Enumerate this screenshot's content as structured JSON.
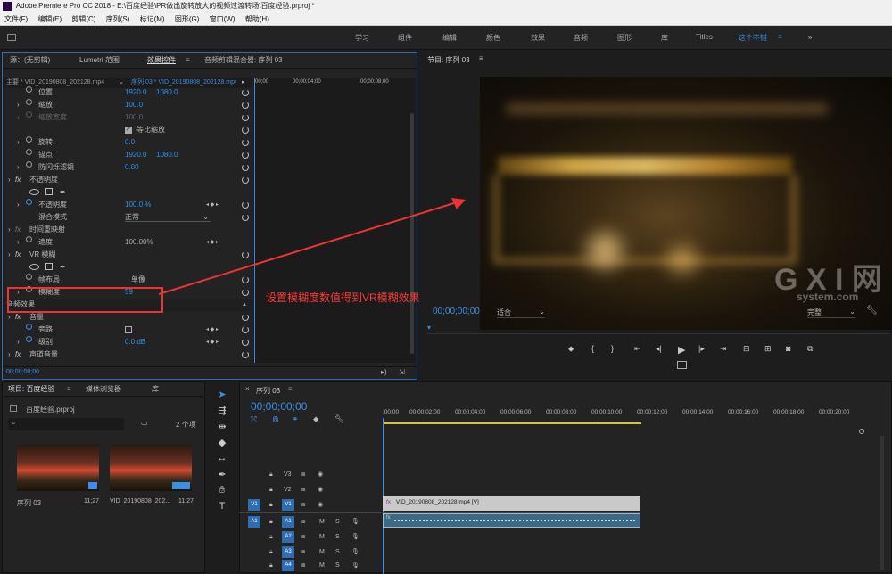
{
  "window": {
    "title": "Adobe Premiere Pro CC 2018 - E:\\百度经验\\PR做出旋转放大的视频过渡转场\\百度经验.prproj *"
  },
  "menu": [
    "文件(F)",
    "编辑(E)",
    "剪辑(C)",
    "序列(S)",
    "标记(M)",
    "图形(G)",
    "窗口(W)",
    "帮助(H)"
  ],
  "workspaces": [
    "学习",
    "组件",
    "编辑",
    "颜色",
    "效果",
    "音频",
    "图形",
    "库",
    "Titles",
    "这个不错",
    "»"
  ],
  "source_panel": {
    "tabs": [
      "源：(无剪辑)",
      "Lumetri 范围",
      "效果控件",
      "音频剪辑混合器: 序列 03"
    ],
    "master": "主要 * VID_20190808_202128.mp4",
    "seq": "序列 03 * VID_20190808_202128.mp4",
    "timecode_top": "00;00",
    "ruler": [
      "00;00;04;00",
      "00;00;08;00"
    ],
    "rows": [
      {
        "label": "位置",
        "v1": "1920.0",
        "v2": "1080.0"
      },
      {
        "label": "缩放",
        "v1": "100.0"
      },
      {
        "label": "缩放宽度",
        "v1": "100.0"
      },
      {
        "label": "等比缩放"
      },
      {
        "label": "旋转",
        "v1": "0.0"
      },
      {
        "label": "锚点",
        "v1": "1920.0",
        "v2": "1080.0"
      },
      {
        "label": "防闪烁滤镜",
        "v1": "0.00"
      },
      {
        "label": "不透明度"
      },
      {
        "label": "不透明度",
        "v1": "100.0 %"
      },
      {
        "label": "混合模式",
        "v1": "正常"
      },
      {
        "label": "时间重映射"
      },
      {
        "label": "速度",
        "v1": "100.00%"
      },
      {
        "label": "VR 模糊"
      },
      {
        "label": "帧布局",
        "v1": "单像"
      },
      {
        "label": "模糊度",
        "v1": "59"
      },
      {
        "label": "音频效果"
      },
      {
        "label": "音量"
      },
      {
        "label": "旁路"
      },
      {
        "label": "级别",
        "v1": "0.0 dB"
      },
      {
        "label": "声道音量"
      }
    ],
    "bottom_timecode": "00;00;00;00",
    "fx_prefix": "fx"
  },
  "program": {
    "title": "节目: 序列 03",
    "timecode": "00;00;00;00",
    "fit": "适合",
    "quality": "完整",
    "annotation": "设置模糊度数值得到VR模糊效果",
    "watermark": "G X I 网",
    "watermark_sub": "system.com"
  },
  "project": {
    "tabs": [
      "项目: 百度经验",
      "媒体浏览器",
      "库"
    ],
    "file": "百度经验.prproj",
    "count": "2 个项",
    "items": [
      {
        "name": "序列 03",
        "duration": "11;27"
      },
      {
        "name": "VID_20190808_202...",
        "duration": "11;27"
      }
    ]
  },
  "timeline": {
    "title": "序列 03",
    "timecode": "00;00;00;00",
    "ruler": [
      ";00;00",
      "00;00;02;00",
      "00;00;04;00",
      "00;00;06;00",
      "00;00;08;00",
      "00;00;10;00",
      "00;00;12;00",
      "00;00;14;00",
      "00;00;16;00",
      "00;00;18;00",
      "00;00;20;00"
    ],
    "tracks_v": [
      "V3",
      "V2",
      "V1"
    ],
    "tracks_a": [
      "A1",
      "A2",
      "A3",
      "A4"
    ],
    "source_v": "V1",
    "source_a": "A1",
    "clip": "VID_20190808_202128.mp4 [V]",
    "mute": "M",
    "solo": "S"
  }
}
